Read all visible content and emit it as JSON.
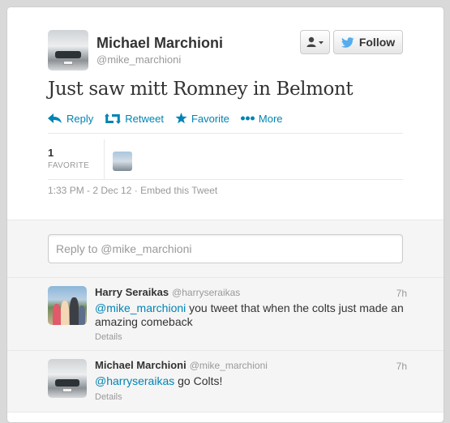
{
  "tweet": {
    "author_name": "Michael Marchioni",
    "author_handle": "@mike_marchioni",
    "text": "Just saw mitt Romney in Belmont",
    "follow_label": "Follow",
    "actions": {
      "reply": "Reply",
      "retweet": "Retweet",
      "favorite": "Favorite",
      "more": "More"
    },
    "stats": {
      "favorite_count": "1",
      "favorite_label": "FAVORITE"
    },
    "timestamp": "1:33 PM - 2 Dec 12",
    "separator": " · ",
    "embed_label": "Embed this Tweet"
  },
  "reply_box": {
    "placeholder": "Reply to @mike_marchioni"
  },
  "replies": [
    {
      "author_name": "Harry Seraikas",
      "author_handle": "@harryseraikas",
      "time": "7h",
      "mention": "@mike_marchioni",
      "text": " you tweet that when the colts just made an amazing comeback",
      "details": "Details"
    },
    {
      "author_name": "Michael Marchioni",
      "author_handle": "@mike_marchioni",
      "time": "7h",
      "mention": "@harryseraikas",
      "text": " go Colts!",
      "details": "Details"
    }
  ],
  "colors": {
    "link": "#0084b4",
    "twitter_blue": "#55acee",
    "background": "#d9d9d9"
  },
  "icons": [
    "user-dropdown-icon",
    "twitter-bird-icon",
    "reply-icon",
    "retweet-icon",
    "favorite-star-icon",
    "more-dots-icon"
  ]
}
